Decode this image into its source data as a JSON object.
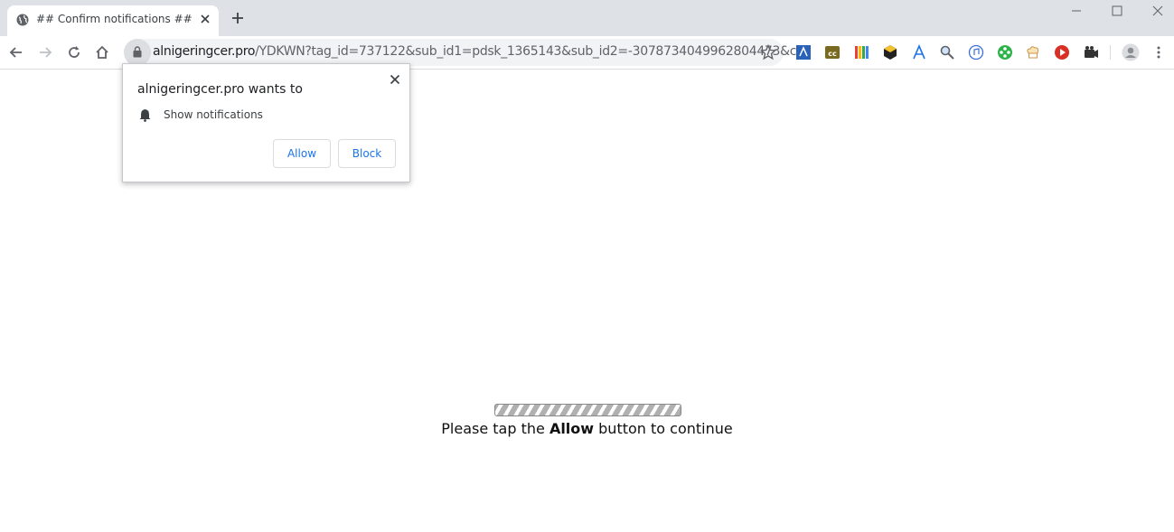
{
  "tab": {
    "title": "## Confirm notifications ##"
  },
  "omnibox": {
    "host": "alnigeringcer.pro",
    "path": "/YDKWN?tag_id=737122&sub_id1=pdsk_1365143&sub_id2=-3078734049962804473&c..."
  },
  "popup": {
    "title": "alnigeringcer.pro wants to",
    "permission": "Show notifications",
    "allow_label": "Allow",
    "block_label": "Block"
  },
  "page": {
    "message_before": "Please tap the ",
    "message_bold": "Allow",
    "message_after": " button to continue"
  },
  "icons": {
    "tab_favicon": "globe-icon",
    "extensions": [
      "ext-blue-icon",
      "ext-cc-icon",
      "ext-books-icon",
      "ext-cube-icon",
      "ext-letter-a-icon",
      "ext-magnifier-icon",
      "ext-music-icon",
      "ext-film-reel-icon",
      "ext-chef-hat-icon",
      "ext-red-play-icon",
      "ext-camera-icon"
    ]
  }
}
